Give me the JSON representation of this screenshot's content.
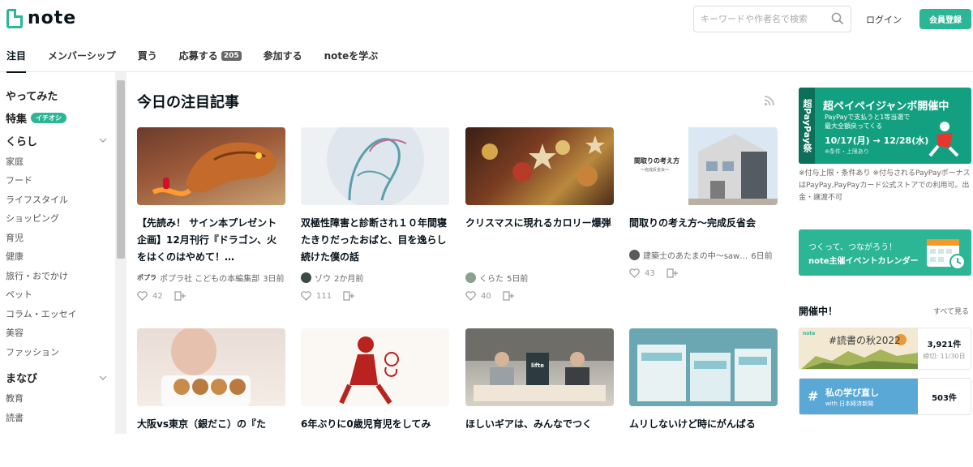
{
  "header": {
    "logo_text": "note",
    "search_placeholder": "キーワードや作者名で検索",
    "login_label": "ログイン",
    "signup_label": "会員登録"
  },
  "nav": {
    "items": [
      {
        "label": "注目"
      },
      {
        "label": "メンバーシップ"
      },
      {
        "label": "買う"
      },
      {
        "label": "応募する",
        "badge": "205"
      },
      {
        "label": "参加する"
      },
      {
        "label": "noteを学ぶ"
      }
    ]
  },
  "sidebar": {
    "try_label": "やってみた",
    "feature_label": "特集",
    "feature_badge": "イチオシ",
    "kurashi_label": "くらし",
    "kurashi_items": [
      "家庭",
      "フード",
      "ライフスタイル",
      "ショッピング",
      "育児",
      "健康",
      "旅行・おでかけ",
      "ペット",
      "コラム・エッセイ",
      "美容",
      "ファッション"
    ],
    "manabi_label": "まなび",
    "manabi_items": [
      "教育",
      "読書"
    ]
  },
  "main": {
    "section_title": "今日の注目記事",
    "cards": [
      {
        "title": "【先読み！ サイン本プレゼント企画】12月刊行『ドラゴン、火をはくのはやめて！…",
        "author": "ポプラ社 こどもの本編集部",
        "time": "3日前",
        "likes": "42",
        "avatar_text": "ポプラ"
      },
      {
        "title": "双極性障害と診断され１０年間寝たきりだったおばと、目を逸らし続けた僕の話",
        "author": "ゾウ",
        "time": "2か月前",
        "likes": "111"
      },
      {
        "title": "クリスマスに現れるカロリー爆弾",
        "author": "くらた",
        "time": "5日前",
        "likes": "40"
      },
      {
        "title": "間取りの考え方～完成反省会",
        "author": "建築士のあたまの中～saw…",
        "time": "6日前",
        "likes": "43",
        "thumb_text": "間取りの考え方",
        "thumb_sub": "〜完成反省会〜"
      },
      {
        "title": "大阪vs東京（銀だこ）の『た"
      },
      {
        "title": "6年ぶりに0歳児育児をしてみ"
      },
      {
        "title": "ほしいギアは、みんなでつく",
        "thumb_text": "lifte"
      },
      {
        "title": "ムリしないけど時にがんばる"
      }
    ]
  },
  "right": {
    "banner1": {
      "side": "超PayPay祭",
      "title": "超ペイペイジャンボ開催中",
      "sub1": "PayPayで支払うと1等当選で",
      "sub2": "最大全額戻ってくる",
      "date": "10/17(月) → 12/28(水)",
      "note": "※条件・上限あり"
    },
    "banner1_note": "※付与上限・条件あり ※付与されるPayPayボーナスはPayPay,PayPayカード公式ストアでの利用可。出金・譲渡不可",
    "banner2": {
      "line1": "つくって、つながろう！",
      "line2": "note主催イベントカレンダー"
    },
    "ongoing_title": "開催中！",
    "see_all": "すべて見る",
    "events": [
      {
        "label": "#読書の秋2022",
        "brand": "note",
        "count": "3,921件",
        "deadline": "締切: 11/30日"
      },
      {
        "label": "私の学び直し",
        "sublabel": "with 日本経済新聞",
        "count": "503件"
      }
    ]
  },
  "colors": {
    "accent": "#2cb696",
    "text": "#08131a"
  }
}
